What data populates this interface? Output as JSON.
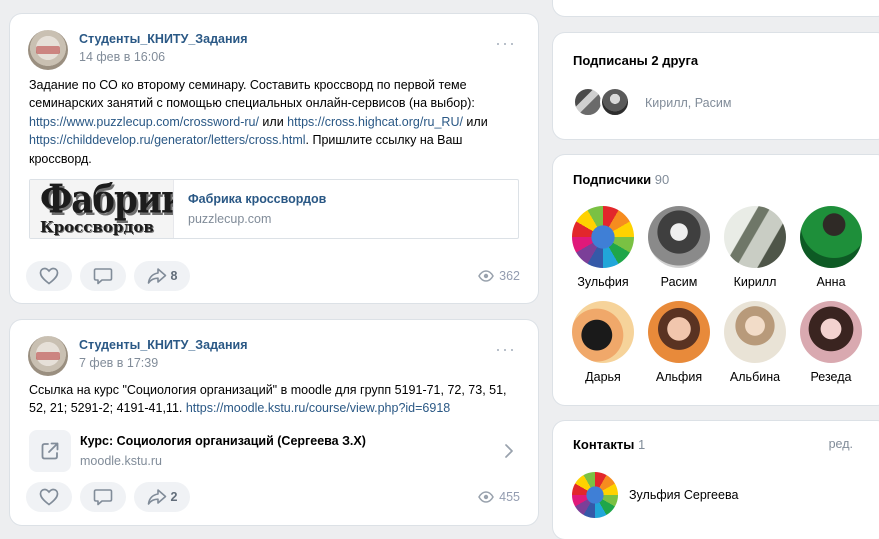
{
  "posts": [
    {
      "author": "Студенты_КНИТУ_Задания",
      "date": "14 фев в 16:06",
      "more": "···",
      "text_before": "Задание по СО ко второму семинару. Составить кроссворд по первой теме семинарских занятий с помощью специальных онлайн-сервисов (на выбор): ",
      "link1": "https://www.puzzlecup.com/crossword-ru/",
      "text_mid1": " или ",
      "link2": "https://cross.highcat.org/ru_RU/",
      "text_mid2": " или ",
      "link3": "https://childdevelop.ru/generator/letters/cross.html",
      "text_after": ". Пришлите ссылку на Ваш кроссворд.",
      "snippet": {
        "logo_line1": "Фабрика",
        "logo_line2": "Кроссвордов",
        "title": "Фабрика кроссвордов",
        "domain": "puzzlecup.com"
      },
      "shares": "8",
      "views": "362"
    },
    {
      "author": "Студенты_КНИТУ_Задания",
      "date": "7 фев в 17:39",
      "more": "···",
      "text_before": "Ссылка на курс \"Социология организаций\" в moodle для групп 5191-71, 72, 73, 51, 52, 21; 5291-2; 4191-41,11. ",
      "link1": "https://moodle.kstu.ru/course/view.php?id=6918",
      "link_block": {
        "title": "Курс: Социология организаций (Сергеева З.Х)",
        "domain": "moodle.kstu.ru"
      },
      "shares": "2",
      "views": "455"
    }
  ],
  "friends": {
    "title": "Подписаны 2 друга",
    "names": "Кирилл, Расим"
  },
  "subscribers": {
    "title": "Подписчики",
    "count": "90",
    "people": [
      {
        "name": "Зульфия",
        "style": "globe"
      },
      {
        "name": "Расим",
        "style": "gray"
      },
      {
        "name": "Кирилл",
        "style": "photo-light"
      },
      {
        "name": "Анна",
        "style": "green"
      },
      {
        "name": "Дарья",
        "style": "sunset"
      },
      {
        "name": "Альфия",
        "style": "orange"
      },
      {
        "name": "Альбина",
        "style": "beige"
      },
      {
        "name": "Резеда",
        "style": "pink"
      }
    ]
  },
  "contacts": {
    "title": "Контакты",
    "count": "1",
    "edit": "ред.",
    "person": "Зульфия Сергеева"
  }
}
